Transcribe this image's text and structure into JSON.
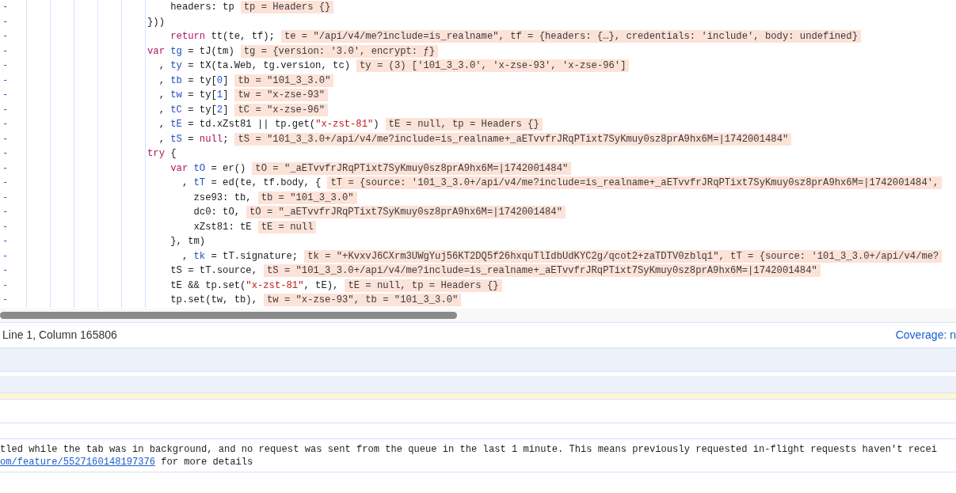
{
  "code_lines": [
    {
      "gutter": "-",
      "tokens": [
        {
          "kind": "plain",
          "text": "    headers: tp"
        }
      ],
      "inline_value": "tp = Headers {}"
    },
    {
      "gutter": "-",
      "tokens": [
        {
          "kind": "plain",
          "text": "}))"
        }
      ]
    },
    {
      "gutter": "-",
      "tokens": [
        {
          "kind": "keyword",
          "text": "    return"
        },
        {
          "kind": "plain",
          "text": " tt(te, tf);"
        }
      ],
      "inline_value": "te = \"/api/v4/me?include=is_realname\", tf = {headers: {…}, credentials: 'include', body: undefined}"
    },
    {
      "gutter": "-",
      "tokens": [
        {
          "kind": "keyword",
          "text": "var "
        },
        {
          "kind": "def",
          "text": "tg"
        },
        {
          "kind": "plain",
          "text": " = tJ(tm)"
        }
      ],
      "inline_value": "tg = {version: '3.0', encrypt: ƒ}"
    },
    {
      "gutter": "-",
      "tokens": [
        {
          "kind": "plain",
          "text": "  , "
        },
        {
          "kind": "def",
          "text": "ty"
        },
        {
          "kind": "plain",
          "text": " = tX(ta.Web, tg.version, tc)"
        }
      ],
      "inline_value": "ty = (3) ['101_3_3.0', 'x-zse-93', 'x-zse-96']"
    },
    {
      "gutter": "-",
      "tokens": [
        {
          "kind": "plain",
          "text": "  , "
        },
        {
          "kind": "def",
          "text": "tb"
        },
        {
          "kind": "plain",
          "text": " = ty["
        },
        {
          "kind": "number",
          "text": "0"
        },
        {
          "kind": "plain",
          "text": "]"
        }
      ],
      "inline_value": "tb = \"101_3_3.0\""
    },
    {
      "gutter": "-",
      "tokens": [
        {
          "kind": "plain",
          "text": "  , "
        },
        {
          "kind": "def",
          "text": "tw"
        },
        {
          "kind": "plain",
          "text": " = ty["
        },
        {
          "kind": "number",
          "text": "1"
        },
        {
          "kind": "plain",
          "text": "]"
        }
      ],
      "inline_value": "tw = \"x-zse-93\""
    },
    {
      "gutter": "-",
      "tokens": [
        {
          "kind": "plain",
          "text": "  , "
        },
        {
          "kind": "def",
          "text": "tC"
        },
        {
          "kind": "plain",
          "text": " = ty["
        },
        {
          "kind": "number",
          "text": "2"
        },
        {
          "kind": "plain",
          "text": "]"
        }
      ],
      "inline_value": "tC = \"x-zse-96\""
    },
    {
      "gutter": "-",
      "tokens": [
        {
          "kind": "plain",
          "text": "  , "
        },
        {
          "kind": "def",
          "text": "tE"
        },
        {
          "kind": "plain",
          "text": " = td.xZst81 || tp.get("
        },
        {
          "kind": "string",
          "text": "\"x-zst-81\""
        },
        {
          "kind": "plain",
          "text": ")"
        }
      ],
      "inline_value": "tE = null, tp = Headers {}"
    },
    {
      "gutter": "-",
      "tokens": [
        {
          "kind": "plain",
          "text": "  , "
        },
        {
          "kind": "def",
          "text": "tS"
        },
        {
          "kind": "plain",
          "text": " = "
        },
        {
          "kind": "keyword",
          "text": "null"
        },
        {
          "kind": "plain",
          "text": ";"
        }
      ],
      "inline_value": "tS = \"101_3_3.0+/api/v4/me?include=is_realname+_aETvvfrJRqPTixt7SyKmuy0sz8prA9hx6M=|1742001484\""
    },
    {
      "gutter": "-",
      "tokens": [
        {
          "kind": "keyword",
          "text": "try"
        },
        {
          "kind": "plain",
          "text": " {"
        }
      ]
    },
    {
      "gutter": "-",
      "tokens": [
        {
          "kind": "keyword",
          "text": "    var "
        },
        {
          "kind": "def",
          "text": "tO"
        },
        {
          "kind": "plain",
          "text": " = er()"
        }
      ],
      "inline_value": "tO = \"_aETvvfrJRqPTixt7SyKmuy0sz8prA9hx6M=|1742001484\""
    },
    {
      "gutter": "-",
      "tokens": [
        {
          "kind": "plain",
          "text": "      , "
        },
        {
          "kind": "def",
          "text": "tT"
        },
        {
          "kind": "plain",
          "text": " = ed(te, tf.body, {"
        }
      ],
      "inline_value": "tT = {source: '101_3_3.0+/api/v4/me?include=is_realname+_aETvvfrJRqPTixt7SyKmuy0sz8prA9hx6M=|1742001484',"
    },
    {
      "gutter": "-",
      "tokens": [
        {
          "kind": "plain",
          "text": "        zse93: tb,"
        }
      ],
      "inline_value": "tb = \"101_3_3.0\""
    },
    {
      "gutter": "-",
      "tokens": [
        {
          "kind": "plain",
          "text": "        dc0: tO,"
        }
      ],
      "inline_value": "tO = \"_aETvvfrJRqPTixt7SyKmuy0sz8prA9hx6M=|1742001484\""
    },
    {
      "gutter": "-",
      "tokens": [
        {
          "kind": "plain",
          "text": "        xZst81: tE"
        }
      ],
      "inline_value": "tE = null"
    },
    {
      "gutter": "-",
      "tokens": [
        {
          "kind": "plain",
          "text": "    }, tm)"
        }
      ]
    },
    {
      "gutter": "-",
      "tokens": [
        {
          "kind": "plain",
          "text": "      , "
        },
        {
          "kind": "def",
          "text": "tk"
        },
        {
          "kind": "plain",
          "text": " = tT.signature;"
        }
      ],
      "inline_value": "tk = \"+KvxvJ6CXrm3UWgYuj56KT2DQ5f26hxquTlIdbUdKYC2g/qcot2+zaTDTV0zblq1\", tT = {source: '101_3_3.0+/api/v4/me?"
    },
    {
      "gutter": "-",
      "tokens": [
        {
          "kind": "plain",
          "text": "    tS = tT.source,"
        }
      ],
      "inline_value": "tS = \"101_3_3.0+/api/v4/me?include=is_realname+_aETvvfrJRqPTixt7SyKmuy0sz8prA9hx6M=|1742001484\""
    },
    {
      "gutter": "-",
      "tokens": [
        {
          "kind": "plain",
          "text": "    tE && tp.set("
        },
        {
          "kind": "string",
          "text": "\"x-zst-81\""
        },
        {
          "kind": "plain",
          "text": ", tE),"
        }
      ],
      "inline_value": "tE = null, tp = Headers {}"
    },
    {
      "gutter": "-",
      "tokens": [
        {
          "kind": "plain",
          "text": "    tp.set(tw, tb),"
        }
      ],
      "inline_value": "tw = \"x-zse-93\", tb = \"101_3_3.0\""
    }
  ],
  "status_bar": {
    "position": "Line 1, Column 165806",
    "coverage_link": "Coverage: n"
  },
  "console_message": {
    "text": "tled while the tab was in background, and no request was sent from the queue in the last 1 minute. This means previously requested in-flight requests haven't recei",
    "link": "om/feature/5527160148197376",
    "suffix": " for more details"
  }
}
